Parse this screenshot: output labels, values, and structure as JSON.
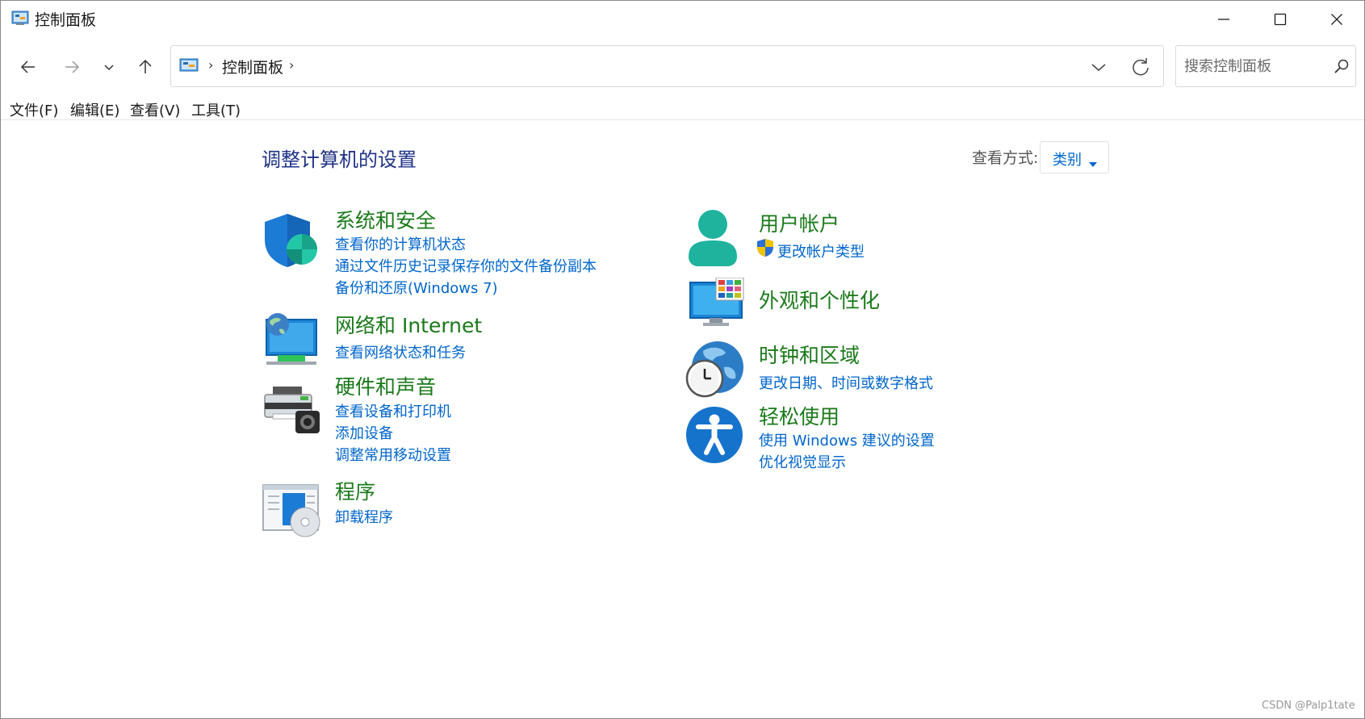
{
  "window": {
    "title": "控制面板",
    "minimize_icon": "minimize-icon",
    "maximize_icon": "maximize-icon",
    "close_icon": "close-icon"
  },
  "toolbar": {
    "back_icon": "arrow-left-icon",
    "forward_icon": "arrow-right-icon",
    "recent_icon": "chevron-down-icon",
    "up_icon": "arrow-up-icon",
    "breadcrumb": [
      "控制面板"
    ],
    "breadcrumb_separator": "›",
    "search_placeholder": "搜索控制面板"
  },
  "menu": {
    "items": [
      "文件(F)",
      "编辑(E)",
      "查看(V)",
      "工具(T)"
    ]
  },
  "main": {
    "title": "调整计算机的设置",
    "view_by_label": "查看方式:",
    "view_by_value": "类别"
  },
  "categories": [
    {
      "title": "系统和安全",
      "icon": "shield-icon",
      "links": [
        "查看你的计算机状态",
        "通过文件历史记录保存你的文件备份副本",
        "备份和还原(Windows 7)"
      ]
    },
    {
      "title": "网络和 Internet",
      "icon": "network-icon",
      "links": [
        "查看网络状态和任务"
      ]
    },
    {
      "title": "硬件和声音",
      "icon": "printer-icon",
      "links": [
        "查看设备和打印机",
        "添加设备",
        "调整常用移动设置"
      ]
    },
    {
      "title": "程序",
      "icon": "programs-icon",
      "links": [
        "卸载程序"
      ]
    },
    {
      "title": "用户帐户",
      "icon": "user-icon",
      "links": [
        "更改帐户类型"
      ]
    },
    {
      "title": "外观和个性化",
      "icon": "appearance-icon",
      "links": []
    },
    {
      "title": "时钟和区域",
      "icon": "clock-globe-icon",
      "links": [
        "更改日期、时间或数字格式"
      ]
    },
    {
      "title": "轻松使用",
      "icon": "accessibility-icon",
      "links": [
        "使用 Windows 建议的设置",
        "优化视觉显示"
      ]
    }
  ],
  "watermark": "CSDN @Palp1tate",
  "colors": {
    "category_title": "#1a7a1a",
    "link": "#0066cc",
    "page_title": "#1e3287",
    "accent": "#0078d4"
  }
}
